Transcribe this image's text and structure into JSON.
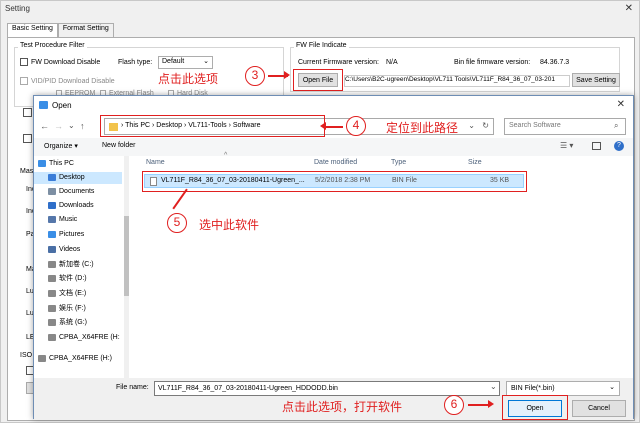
{
  "settings": {
    "title": "Setting",
    "tabs": [
      "Basic Setting",
      "Format Setting"
    ],
    "test_procedure_group": "Test Procedure Filter",
    "fw_download_disable": "FW Download Disable",
    "vid_pid_disable": "VID/PID Download Disable",
    "eeprom": "EEPROM",
    "external_flash": "External Flash",
    "hard_disk": "Hard Disk",
    "flash_type_label": "Flash type:",
    "flash_type_value": "Default",
    "fw_file_group": "FW File Indicate",
    "current_fw_label": "Current Firmware version:",
    "current_fw_value": "N/A",
    "bin_fw_label": "Bin file firmware version:",
    "bin_fw_value": "84.36.7.3",
    "open_file_button": "Open File",
    "path_value": "C:\\Users\\B2C-ugreen\\Desktop\\VL711 Tools\\VL711F_R84_36_07_03-201",
    "save_setting_button": "Save Setting",
    "left_labels": [
      "Mas",
      "Inc",
      "Inc",
      "Pa",
      "Ma",
      "Lu",
      "Lu",
      "LE",
      "ISO"
    ]
  },
  "dialog": {
    "title": "Open",
    "breadcrumb": [
      "This PC",
      "Desktop",
      "VL711-Tools",
      "Software"
    ],
    "search_placeholder": "Search Software",
    "organize_label": "Organize",
    "new_folder_label": "New folder",
    "nav_items": [
      {
        "label": "This PC",
        "color": "#3a8ee6"
      },
      {
        "label": "Desktop",
        "color": "#3b7dd8"
      },
      {
        "label": "Documents",
        "color": "#7d8fa3"
      },
      {
        "label": "Downloads",
        "color": "#2f6fc9"
      },
      {
        "label": "Music",
        "color": "#5577aa"
      },
      {
        "label": "Pictures",
        "color": "#3a8ee6"
      },
      {
        "label": "Videos",
        "color": "#4a6fa5"
      },
      {
        "label": "新加卷 (C:)",
        "color": "#888888"
      },
      {
        "label": "软件 (D:)",
        "color": "#888888"
      },
      {
        "label": "文档 (E:)",
        "color": "#888888"
      },
      {
        "label": "娱乐 (F:)",
        "color": "#888888"
      },
      {
        "label": "系统 (G:)",
        "color": "#888888"
      },
      {
        "label": "CPBA_X64FRE (H:",
        "color": "#888888"
      },
      {
        "label": "CPBA_X64FRE (H:)",
        "color": "#888888"
      }
    ],
    "columns": [
      "Name",
      "Date modified",
      "Type",
      "Size"
    ],
    "file": {
      "name": "VL711F_R84_36_07_03-20180411-Ugreen_...",
      "date": "5/2/2018 2:38 PM",
      "type": "BIN File",
      "size": "35 KB"
    },
    "file_name_label": "File name:",
    "file_name_value": "VL711F_R84_36_07_03-20180411-Ugreen_HDDODD.bin",
    "file_type_value": "BIN File(*.bin)",
    "open_button": "Open",
    "cancel_button": "Cancel"
  },
  "annotations": {
    "step3_text": "点击此选项",
    "step3_num": "3",
    "step4_text": "定位到此路径",
    "step4_num": "4",
    "step5_text": "选中此软件",
    "step5_num": "5",
    "step6_text": "点击此选项，打开软件",
    "step6_num": "6",
    "color": "#e02020"
  }
}
